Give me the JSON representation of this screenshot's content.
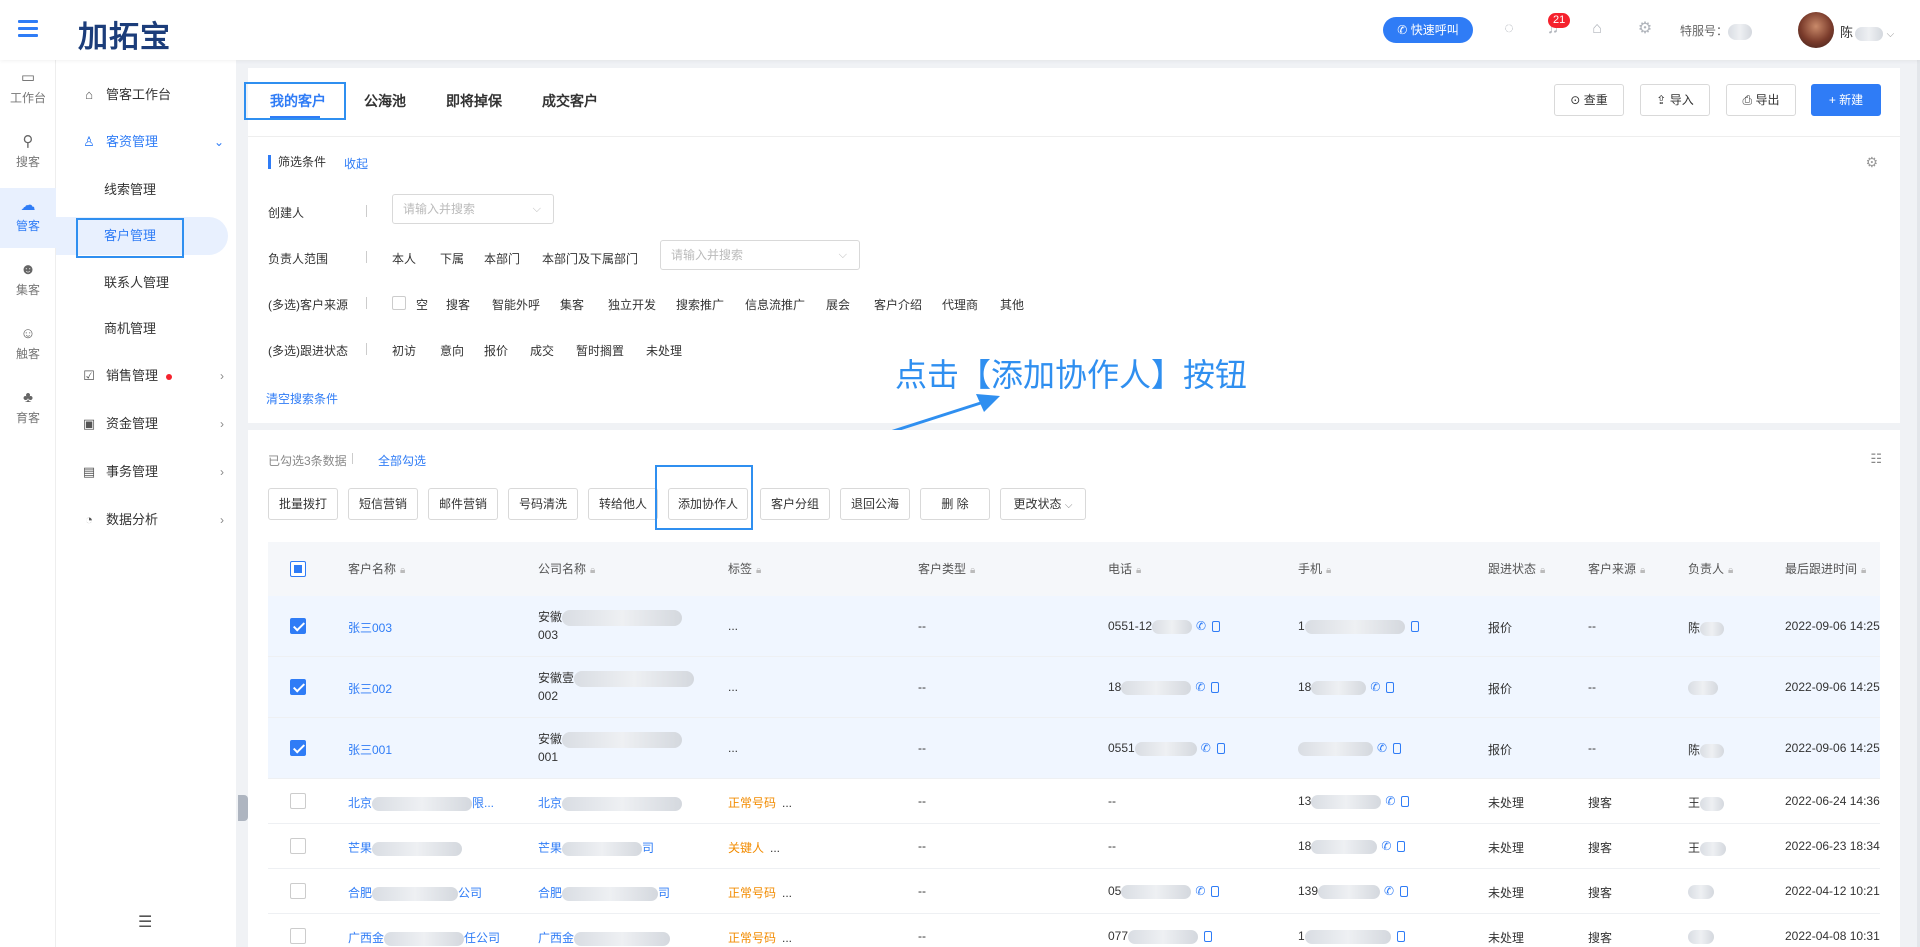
{
  "app": {
    "logo": "加拓宝",
    "quick_call": "快速呼叫",
    "notif_count": "21",
    "service_label": "特服号：",
    "user_name": "陈"
  },
  "rail": [
    {
      "label": "工作台",
      "icon": "monitor-icon"
    },
    {
      "label": "搜客",
      "icon": "search-user-icon"
    },
    {
      "label": "管客",
      "icon": "cloud-icon"
    },
    {
      "label": "集客",
      "icon": "group-icon"
    },
    {
      "label": "触客",
      "icon": "contact-icon"
    },
    {
      "label": "育客",
      "icon": "nurture-icon"
    }
  ],
  "sidenav": {
    "workbench": "管客工作台",
    "resource_mgmt": "客资管理",
    "leads": "线索管理",
    "customers": "客户管理",
    "contacts": "联系人管理",
    "opportunities": "商机管理",
    "sales": "销售管理",
    "funds": "资金管理",
    "affairs": "事务管理",
    "analytics": "数据分析"
  },
  "tabs": [
    "我的客户",
    "公海池",
    "即将掉保",
    "成交客户"
  ],
  "header_buttons": {
    "dedupe": "查重",
    "import": "导入",
    "export": "导出",
    "new": "+ 新建"
  },
  "filter": {
    "title": "筛选条件",
    "collapse": "收起",
    "creator_label": "创建人",
    "creator_placeholder": "请输入并搜索",
    "owner_label": "负责人范围",
    "owner_options": [
      "本人",
      "下属",
      "本部门",
      "本部门及下属部门"
    ],
    "owner_placeholder": "请输入并搜索",
    "source_label": "(多选)客户来源",
    "source_options": [
      "空",
      "搜客",
      "智能外呼",
      "集客",
      "独立开发",
      "搜索推广",
      "信息流推广",
      "展会",
      "客户介绍",
      "代理商",
      "其他"
    ],
    "status_label": "(多选)跟进状态",
    "status_options": [
      "初访",
      "意向",
      "报价",
      "成交",
      "暂时搁置",
      "未处理"
    ],
    "clear": "清空搜索条件"
  },
  "annotation": "点击【添加协作人】按钮",
  "list": {
    "selected_info": "已勾选3条数据",
    "select_all": "全部勾选",
    "actions": [
      "批量拨打",
      "短信营销",
      "邮件营销",
      "号码清洗",
      "转给他人",
      "添加协作人",
      "客户分组",
      "退回公海",
      "删 除",
      "更改状态"
    ],
    "columns": [
      "客户名称",
      "公司名称",
      "标签",
      "客户类型",
      "电话",
      "手机",
      "跟进状态",
      "客户来源",
      "负责人",
      "最后跟进时间"
    ],
    "rows": [
      {
        "name": "张三003",
        "company": "安徽",
        "company2": "003",
        "tag": "...",
        "type": "--",
        "phone": "0551-12",
        "mobile": "1",
        "status": "报价",
        "source": "--",
        "owner": "陈",
        "time": "2022-09-06 14:25"
      },
      {
        "name": "张三002",
        "company": "安徽壹",
        "company2": "002",
        "tag": "...",
        "type": "--",
        "phone": "18",
        "mobile": "18",
        "status": "报价",
        "source": "--",
        "owner": "",
        "time": "2022-09-06 14:25"
      },
      {
        "name": "张三001",
        "company": "安徽",
        "company2": "001",
        "tag": "...",
        "type": "--",
        "phone": "0551",
        "mobile": "",
        "status": "报价",
        "source": "--",
        "owner": "陈",
        "time": "2022-09-06 14:25"
      },
      {
        "name": "北京",
        "company": "北京",
        "tag": "正常号码",
        "type": "--",
        "phone": "--",
        "mobile": "13",
        "status": "未处理",
        "source": "搜客",
        "owner": "王",
        "time": "2022-06-24 14:36"
      },
      {
        "name": "芒果",
        "company": "芒果",
        "tag": "关键人",
        "type": "--",
        "phone": "--",
        "mobile": "18",
        "status": "未处理",
        "source": "搜客",
        "owner": "王",
        "time": "2022-06-23 18:34"
      },
      {
        "name": "合肥",
        "company": "合肥",
        "tag": "正常号码",
        "type": "--",
        "phone": "05",
        "mobile": "139",
        "status": "未处理",
        "source": "搜客",
        "owner": "",
        "time": "2022-04-12 10:21"
      },
      {
        "name": "广西金",
        "company": "广西金",
        "tag": "正常号码",
        "type": "--",
        "phone": "077",
        "mobile": "1",
        "status": "未处理",
        "source": "搜客",
        "owner": "",
        "time": "2022-04-08 10:31"
      }
    ]
  }
}
